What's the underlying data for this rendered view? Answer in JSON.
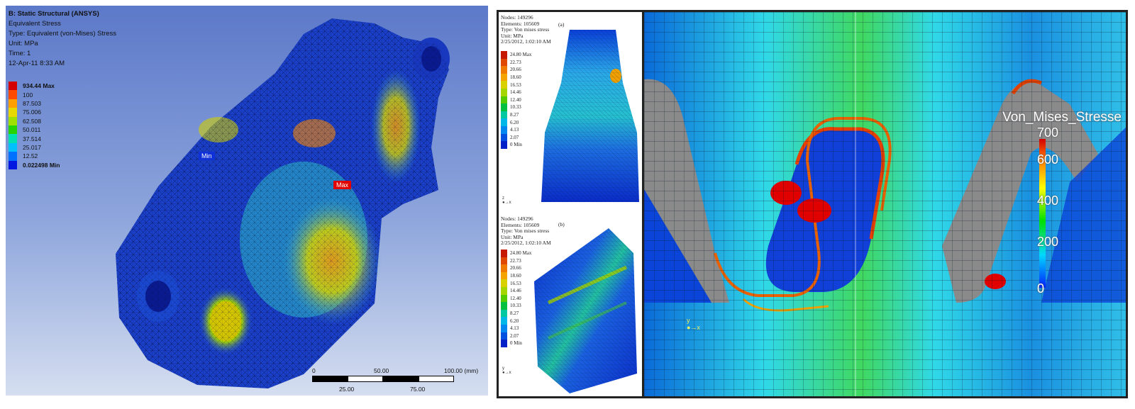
{
  "left_panel": {
    "header": [
      "B: Static Structural (ANSYS)",
      "Equivalent Stress",
      "Type: Equivalent (von-Mises) Stress",
      "Unit: MPa",
      "Time: 1",
      "12-Apr-11 8:33 AM"
    ],
    "legend": [
      {
        "label": "934.44 Max",
        "color": "#d40000",
        "bold": true
      },
      {
        "label": "100",
        "color": "#ff4a00",
        "bold": false
      },
      {
        "label": "87.503",
        "color": "#ff9f00",
        "bold": false
      },
      {
        "label": "75.006",
        "color": "#e6d800",
        "bold": false
      },
      {
        "label": "62.508",
        "color": "#9fe000",
        "bold": false
      },
      {
        "label": "50.011",
        "color": "#25d400",
        "bold": false
      },
      {
        "label": "37.514",
        "color": "#00e0b0",
        "bold": false
      },
      {
        "label": "25.017",
        "color": "#00c0ff",
        "bold": false
      },
      {
        "label": "12.52",
        "color": "#0070ff",
        "bold": false
      },
      {
        "label": "0.022498 Min",
        "color": "#0018e0",
        "bold": true
      }
    ],
    "min_tag": "Min",
    "max_tag": "Max",
    "scale": {
      "top_labels": [
        "0",
        "50.00",
        "100.00 (mm)"
      ],
      "bottom_labels": [
        "25.00",
        "75.00"
      ]
    }
  },
  "gear_a": {
    "info": [
      "Nodes: 149296",
      "Elements: 105609",
      "Type: Von mises stress",
      "Unit: MPa",
      "2/25/2012, 1:02:10 AM"
    ],
    "label": "(a)"
  },
  "gear_b": {
    "info": [
      "Nodes: 149296",
      "Elements: 105609",
      "Type: Von mises stress",
      "Unit: MPa",
      "2/25/2012, 1:02:10 AM"
    ],
    "label": "(b)"
  },
  "gear_legend": [
    {
      "label": "24.80 Max",
      "color": "#c61a00"
    },
    {
      "label": "22.73",
      "color": "#e04800"
    },
    {
      "label": "20.66",
      "color": "#f07a00"
    },
    {
      "label": "18.60",
      "color": "#f5a300"
    },
    {
      "label": "16.53",
      "color": "#d8d000"
    },
    {
      "label": "14.46",
      "color": "#a6d600"
    },
    {
      "label": "12.40",
      "color": "#55cc00"
    },
    {
      "label": "10.33",
      "color": "#00c040"
    },
    {
      "label": "8.27",
      "color": "#00c8a0"
    },
    {
      "label": "6.20",
      "color": "#00b8e8"
    },
    {
      "label": "4.13",
      "color": "#0088f0"
    },
    {
      "label": "2.07",
      "color": "#0050e0"
    },
    {
      "label": "0 Min",
      "color": "#0020c8"
    }
  ],
  "von_mises": {
    "title": "Von_Mises_Stresse",
    "ticks": [
      "700",
      "600",
      "400",
      "200",
      "0"
    ]
  }
}
